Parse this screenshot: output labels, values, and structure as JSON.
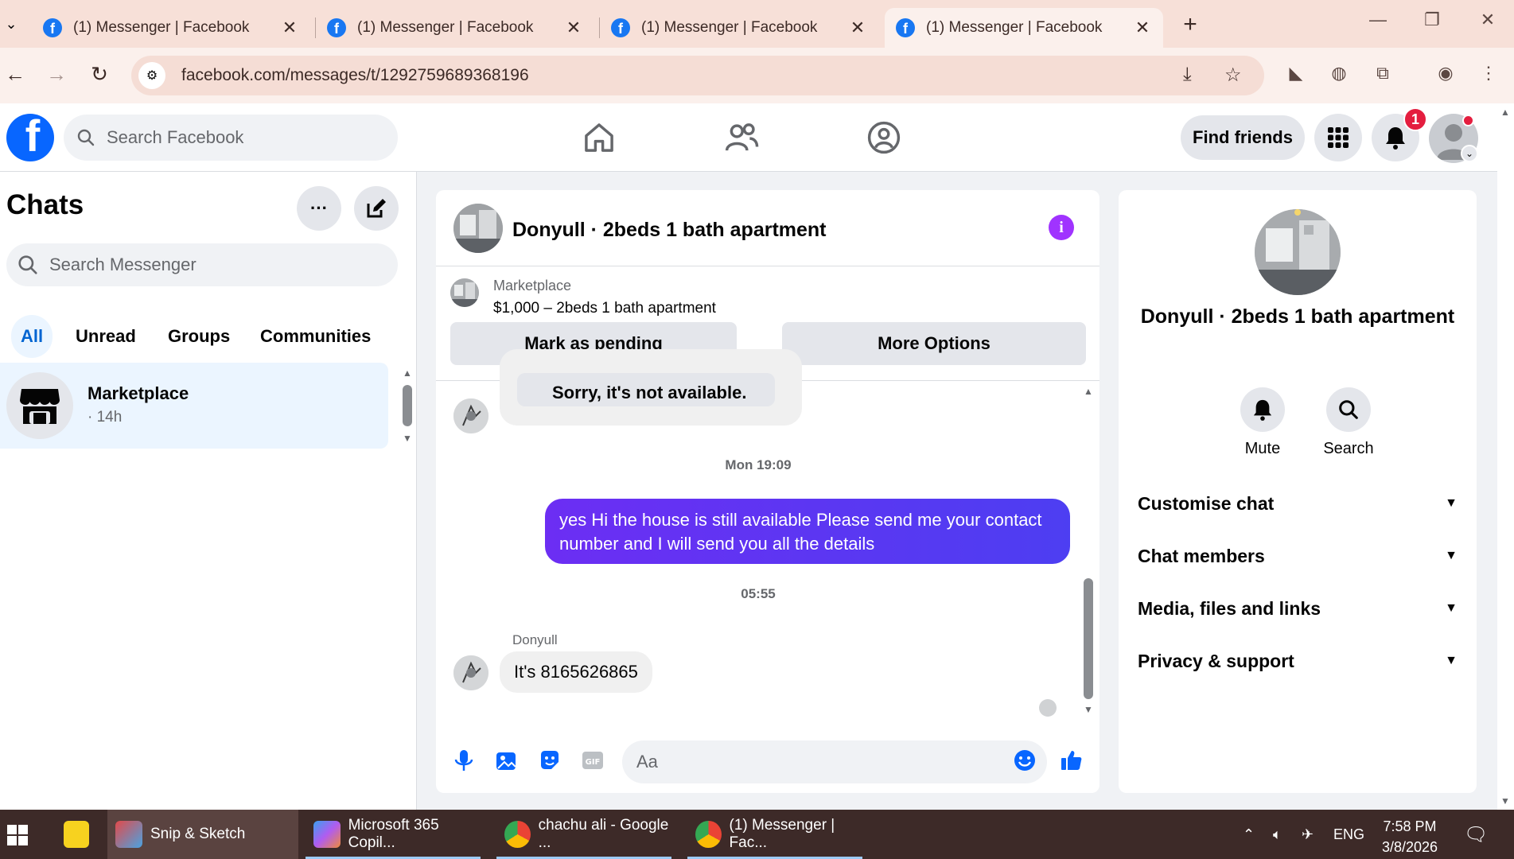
{
  "browser": {
    "tabs": [
      {
        "title": "(1) Messenger | Facebook",
        "active": false
      },
      {
        "title": "(1) Messenger | Facebook",
        "active": false
      },
      {
        "title": "(1) Messenger | Facebook",
        "active": false
      },
      {
        "title": "(1) Messenger | Facebook",
        "active": true
      }
    ],
    "url": "facebook.com/messages/t/1292759689368196"
  },
  "fb_header": {
    "search_placeholder": "Search Facebook",
    "find_friends": "Find friends",
    "notification_count": "1"
  },
  "sidebar": {
    "title": "Chats",
    "search_placeholder": "Search Messenger",
    "filters": [
      "All",
      "Unread",
      "Groups",
      "Communities"
    ],
    "active_filter": "All",
    "chats": [
      {
        "name": "Marketplace",
        "sub": "· 14h"
      }
    ]
  },
  "chat": {
    "header_name": "Donyull · 2beds 1 bath apartment",
    "listing_label": "Marketplace",
    "listing_title": "$1,000 – 2beds 1 bath apartment",
    "mark_pending": "Mark as pending",
    "more_options": "More Options",
    "messages": [
      {
        "text": "Sorry, it's not available."
      },
      {
        "time": "Mon 19:09"
      },
      {
        "text": "yes Hi the house is still available Please send me your contact number and I will send you all the details"
      },
      {
        "time": "05:55"
      },
      {
        "sender": "Donyull",
        "text": "It's 8165626865"
      }
    ],
    "composer_placeholder": "Aa"
  },
  "info_panel": {
    "name": "Donyull · 2beds 1 bath apartment",
    "actions": [
      "Mute",
      "Search"
    ],
    "sections": [
      "Customise chat",
      "Chat members",
      "Media, files and links",
      "Privacy & support"
    ]
  },
  "taskbar": {
    "items": [
      "Snip & Sketch",
      "Microsoft 365 Copil...",
      "chachu ali - Google ...",
      "(1) Messenger | Fac..."
    ],
    "lang": "ENG",
    "time": "7:58 PM",
    "date": "3/8/2026"
  },
  "colors": {
    "fb_blue": "#0866ff",
    "outgoing_bubble": "#5d2ff0",
    "badge_red": "#e41e3f",
    "info_purple": "#a033ff"
  }
}
